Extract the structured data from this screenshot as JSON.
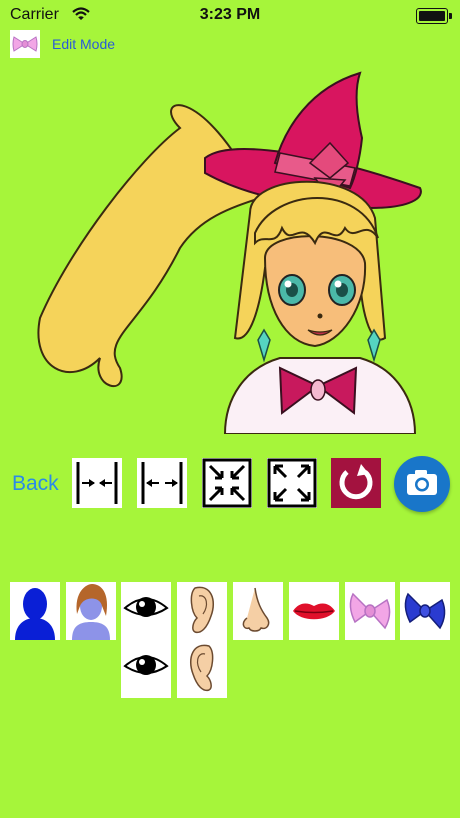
{
  "status_bar": {
    "carrier": "Carrier",
    "time": "3:23 PM",
    "battery_level": 1.0
  },
  "header": {
    "edit_icon": "bow-icon",
    "edit_mode_label": "Edit Mode"
  },
  "avatar": {
    "description_icons": [
      "witch-hat",
      "ponytail-hair",
      "face",
      "bow-tie"
    ]
  },
  "toolbar": {
    "back_label": "Back",
    "tools": [
      {
        "name": "shrink-horizontal-icon"
      },
      {
        "name": "expand-horizontal-icon"
      },
      {
        "name": "shrink-icon"
      },
      {
        "name": "expand-icon"
      },
      {
        "name": "reset-icon"
      },
      {
        "name": "camera-icon"
      }
    ]
  },
  "parts_palette": {
    "items": [
      {
        "name": "face-shape-icon",
        "color": "#0a1fd6"
      },
      {
        "name": "hair-icon",
        "color": "#b5662b"
      },
      {
        "name": "eyes-icon",
        "color": "#000000"
      },
      {
        "name": "ears-icon",
        "color": "#f5cfa5"
      },
      {
        "name": "nose-icon",
        "color": "#f5cfa5"
      },
      {
        "name": "lips-icon",
        "color": "#e0102b"
      },
      {
        "name": "pink-bow-icon",
        "color": "#f2a6e6"
      },
      {
        "name": "blue-bow-icon",
        "color": "#2a3bd0"
      }
    ]
  },
  "colors": {
    "background": "#a6f53a",
    "link_blue": "#2a8ae8",
    "hat": "#d8155f",
    "hair": "#f5d35a",
    "skin": "#f7be7a"
  }
}
